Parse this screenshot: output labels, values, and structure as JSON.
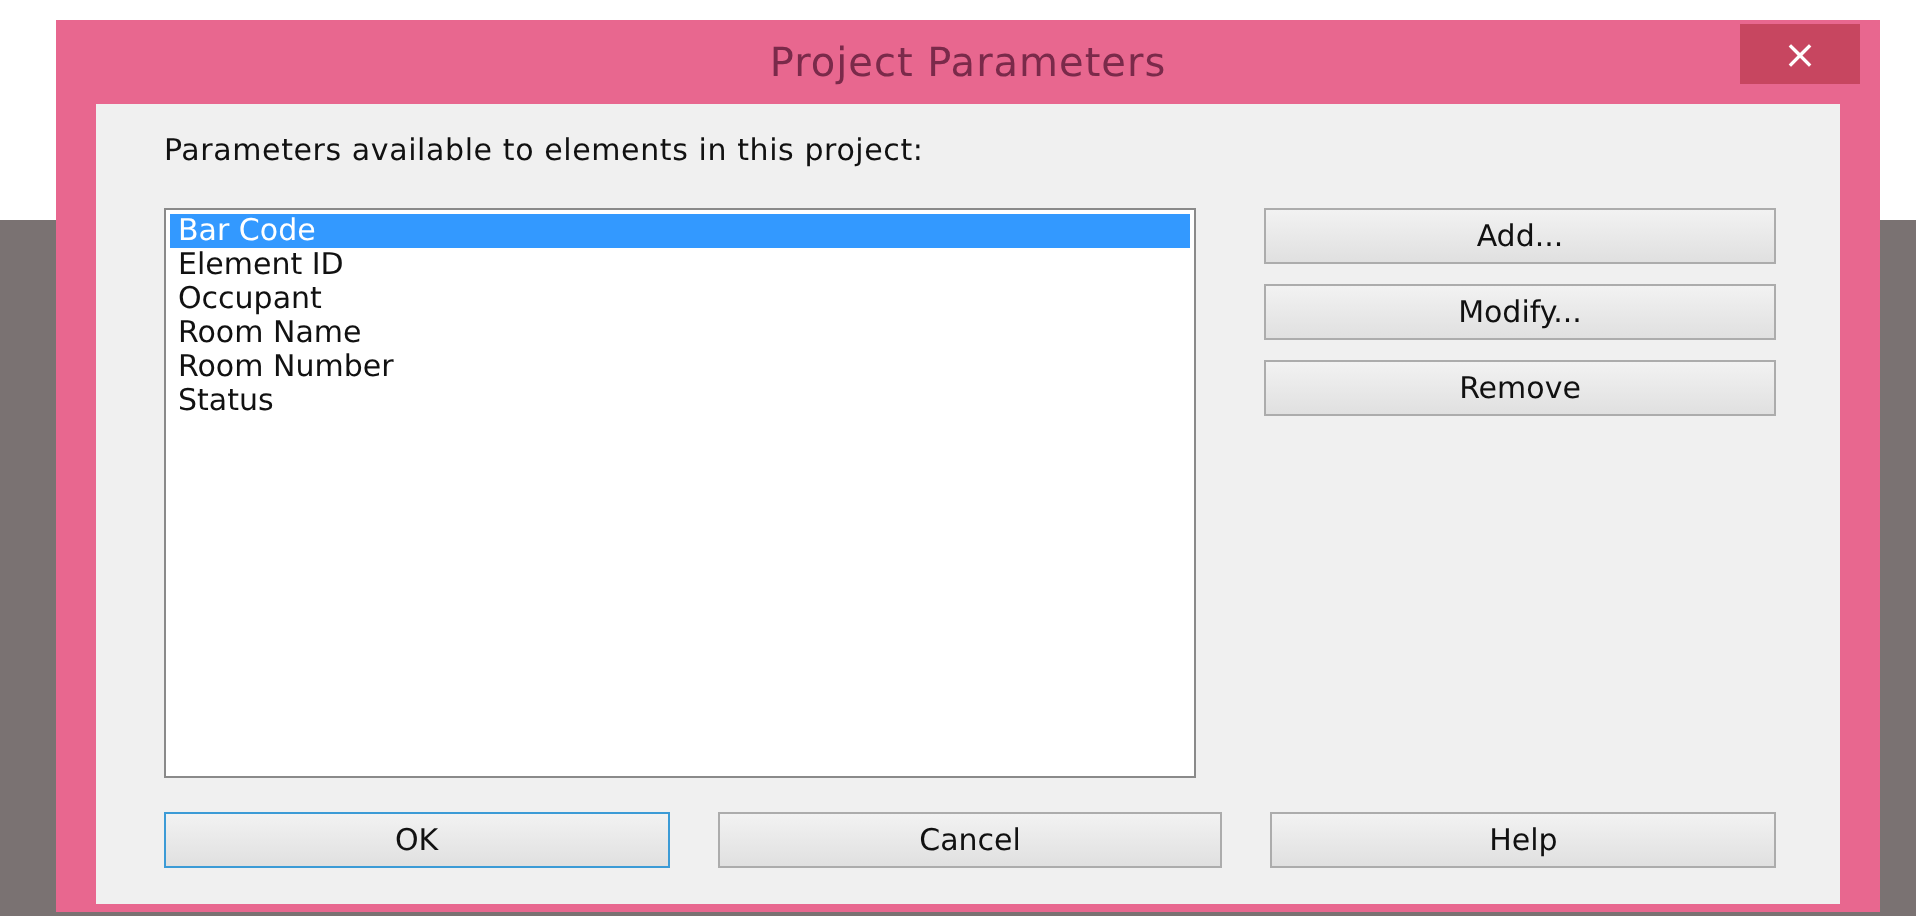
{
  "window": {
    "title": "Project Parameters",
    "close": "×"
  },
  "prompt": "Parameters available to elements in this project:",
  "parameters": [
    {
      "label": "Bar Code",
      "selected": true
    },
    {
      "label": "Element ID",
      "selected": false
    },
    {
      "label": "Occupant",
      "selected": false
    },
    {
      "label": "Room Name",
      "selected": false
    },
    {
      "label": "Room Number",
      "selected": false
    },
    {
      "label": "Status",
      "selected": false
    }
  ],
  "side_buttons": [
    "Add...",
    "Modify...",
    "Remove"
  ],
  "footer_buttons": [
    {
      "label": "OK",
      "default": true
    },
    {
      "label": "Cancel",
      "default": false
    },
    {
      "label": "Help",
      "default": false
    }
  ]
}
